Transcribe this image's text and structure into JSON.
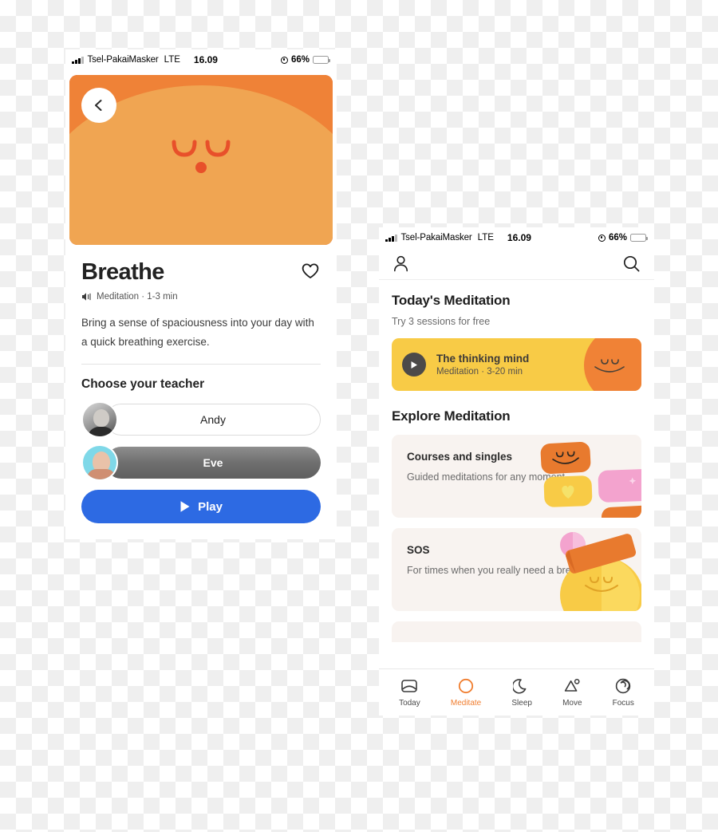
{
  "background": {
    "type": "transparency-checkerboard",
    "colors": [
      "#ffffff",
      "#efefef"
    ]
  },
  "status_bar": {
    "carrier": "Tsel-PakaiMasker",
    "network": "LTE",
    "time": "16.09",
    "battery_percent": "66%",
    "location_icon": "location-arrow-icon",
    "signal_icon": "signal-bars-icon",
    "battery_icon": "battery-icon"
  },
  "phone_breathe": {
    "name": "Breathe detail screen",
    "hero": {
      "back_icon": "chevron-left-icon",
      "face_icon": "calm-sleeping-face-illustration",
      "colors": {
        "outer": "#E0553C",
        "band2": "#E96F31",
        "band3": "#EF8237",
        "inner": "#F0A552"
      }
    },
    "title": "Breathe",
    "favorite_icon": "heart-outline-icon",
    "meta_icon": "audio-waves-icon",
    "meta": "Meditation · 1-3 min",
    "description": "Bring a sense of spaciousness into your day with a quick breathing exercise.",
    "section_title": "Choose your teacher",
    "teachers": [
      {
        "name": "Andy",
        "avatar": "teacher-avatar-andy",
        "selected": false
      },
      {
        "name": "Eve",
        "avatar": "teacher-avatar-eve",
        "selected": true
      }
    ],
    "play_button": {
      "label": "Play",
      "icon": "play-triangle-icon",
      "color": "#2d6ae3"
    }
  },
  "phone_meditate": {
    "name": "Meditate tab screen",
    "nav": {
      "profile_icon": "person-icon",
      "search_icon": "search-icon"
    },
    "today_section": {
      "title": "Today's Meditation",
      "subtitle": "Try 3 sessions for free",
      "card": {
        "play_icon": "play-circle-icon",
        "title": "The thinking mind",
        "meta": "Meditation · 3-20 min",
        "bg_color": "#F8CB46",
        "blob_color": "#F08236",
        "art": "smiling-face-blob-illustration"
      }
    },
    "explore_section": {
      "title": "Explore Meditation",
      "cards": [
        {
          "title": "Courses and singles",
          "desc": "Guided meditations for any moment.",
          "art": "stacked-cards-illustration",
          "bg_color": "#F8F3F0"
        },
        {
          "title": "SOS",
          "desc": "For times when you really need a break.",
          "art": "sos-blob-illustration",
          "bg_color": "#F8F3F0"
        }
      ]
    },
    "tabbar": {
      "active": "Meditate",
      "accent_color": "#F07D2E",
      "items": [
        {
          "label": "Today",
          "icon": "today-card-icon"
        },
        {
          "label": "Meditate",
          "icon": "circle-icon"
        },
        {
          "label": "Sleep",
          "icon": "moon-icon"
        },
        {
          "label": "Move",
          "icon": "move-mountain-icon"
        },
        {
          "label": "Focus",
          "icon": "spiral-icon"
        }
      ]
    }
  }
}
